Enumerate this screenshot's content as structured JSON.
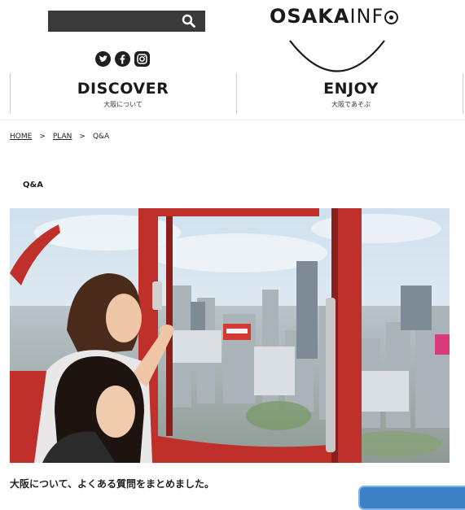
{
  "header": {
    "search": {
      "placeholder": ""
    },
    "social_icons": [
      "twitter-icon",
      "facebook-icon",
      "instagram-icon"
    ],
    "logo": {
      "bold_part": "OSAKA",
      "light_part": "INF",
      "last_letter": "O"
    }
  },
  "nav": {
    "items": [
      {
        "title": "DISCOVER",
        "subtitle": "大阪について"
      },
      {
        "title": "ENJOY",
        "subtitle": "大阪であそぶ"
      }
    ]
  },
  "breadcrumb": {
    "items": [
      "HOME",
      "PLAN",
      "Q&A"
    ],
    "separator": ">"
  },
  "page": {
    "title": "Q&A",
    "intro": "大阪について、よくある質問をまとめました。"
  },
  "hero": {
    "alt": "photo"
  },
  "colors": {
    "search_bg": "#3a3a3a",
    "float_button": "#3b7fc4",
    "gondola_red": "#c0302a"
  }
}
